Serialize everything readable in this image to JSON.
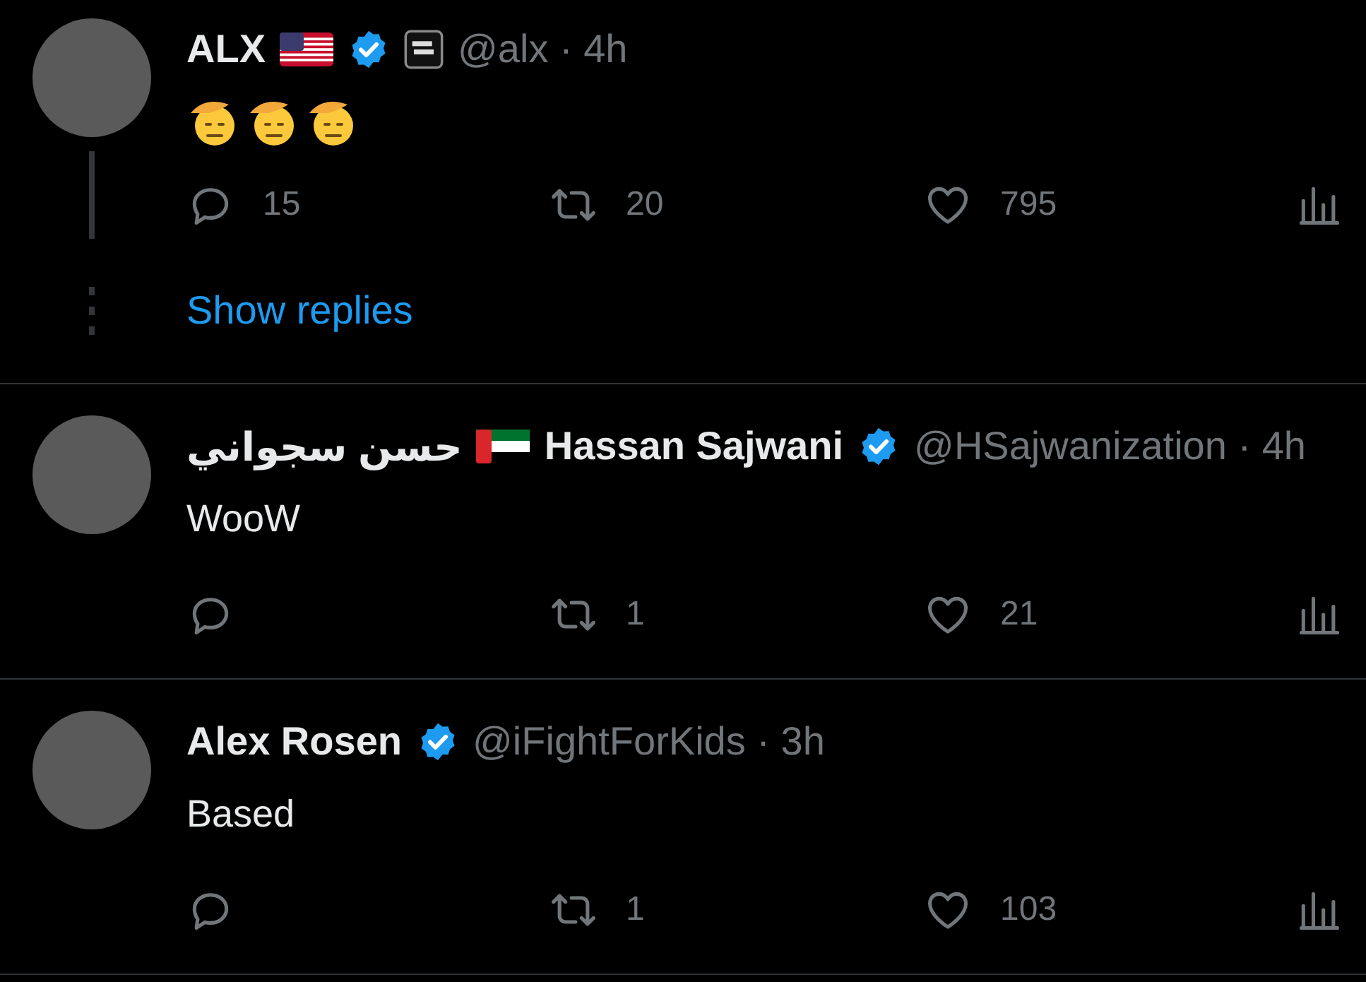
{
  "tweets": [
    {
      "thread_line": true,
      "header": [
        {
          "kind": "name",
          "text": "ALX"
        },
        {
          "kind": "flag-us"
        },
        {
          "kind": "verified"
        },
        {
          "kind": "affiliate"
        },
        {
          "kind": "meta",
          "text": "@alx · 4h"
        }
      ],
      "emoji": [
        {
          "kind": "saluting-face"
        },
        {
          "kind": "saluting-face"
        },
        {
          "kind": "saluting-face"
        }
      ],
      "stats": {
        "replies": "15",
        "reposts": "20",
        "likes": "795"
      },
      "show_replies": "Show replies"
    },
    {
      "thread_line": false,
      "header": [
        {
          "kind": "name",
          "text": "حسن سجواني"
        },
        {
          "kind": "flag-ae"
        },
        {
          "kind": "name",
          "text": "Hassan Sajwani"
        },
        {
          "kind": "verified"
        },
        {
          "kind": "meta",
          "text": "@HSajwanization · 4h"
        }
      ],
      "text": "WooW",
      "stats": {
        "reposts": "1",
        "likes": "21"
      }
    },
    {
      "thread_line": false,
      "header": [
        {
          "kind": "name",
          "text": "Alex Rosen"
        },
        {
          "kind": "verified"
        },
        {
          "kind": "meta",
          "text": "@iFightForKids · 3h"
        }
      ],
      "text": "Based",
      "stats": {
        "reposts": "1",
        "likes": "103"
      }
    }
  ]
}
